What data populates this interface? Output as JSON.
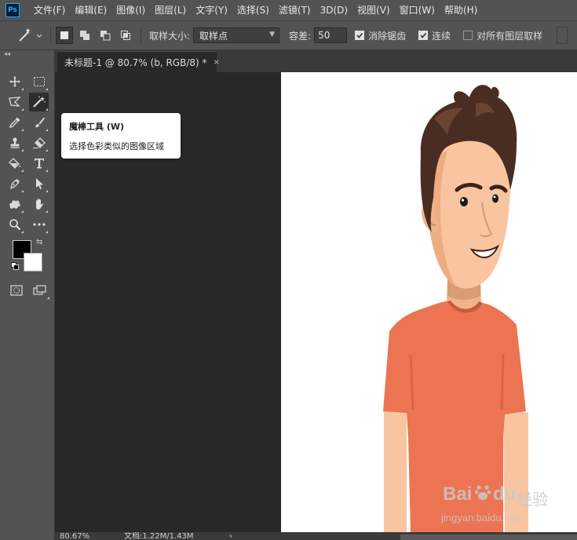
{
  "app": {
    "logo_text": "Ps"
  },
  "menu": [
    "文件(F)",
    "编辑(E)",
    "图像(I)",
    "图层(L)",
    "文字(Y)",
    "选择(S)",
    "滤镜(T)",
    "3D(D)",
    "视图(V)",
    "窗口(W)",
    "帮助(H)"
  ],
  "options": {
    "sample_size_label": "取样大小:",
    "sample_size_value": "取样点",
    "tolerance_label": "容差:",
    "tolerance_value": "50",
    "anti_alias_label": "消除锯齿",
    "anti_alias_checked": true,
    "contiguous_label": "连续",
    "contiguous_checked": true,
    "all_layers_label": "对所有图层取样",
    "all_layers_checked": false
  },
  "document": {
    "tab_title": "未标题-1 @ 80.7% (b, RGB/8) *",
    "close_glyph": "×"
  },
  "tooltip": {
    "title": "魔棒工具 (W)",
    "description": "选择色彩类似的图像区域"
  },
  "status": {
    "zoom": "80.67%",
    "doc_info": "文档:1.22M/1.43M"
  },
  "colors": {
    "foreground": "#000000",
    "background": "#ffffff",
    "shirt": "#ec7452",
    "skin": "#f8c5a0",
    "hair": "#4a2d22"
  },
  "watermark": {
    "brand": "Bai",
    "paw": "du",
    "product": "经验",
    "url": "jingyan.baidu.com"
  }
}
